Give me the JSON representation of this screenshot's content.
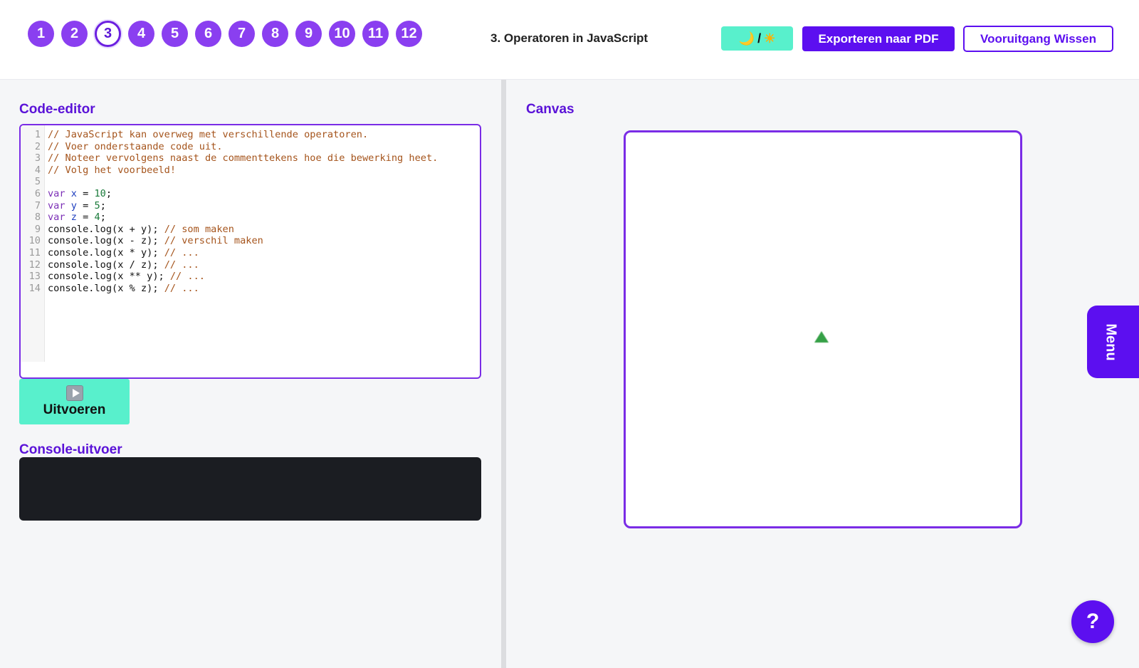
{
  "header": {
    "lessons": [
      "1",
      "2",
      "3",
      "4",
      "5",
      "6",
      "7",
      "8",
      "9",
      "10",
      "11",
      "12"
    ],
    "active_lesson": "3",
    "title": "3. Operatoren in JavaScript",
    "theme_toggle": {
      "moon_icon": "🌙",
      "separator": "/",
      "sun_icon": "☀"
    },
    "export_pdf_label": "Exporteren naar PDF",
    "reset_progress_label": "Vooruitgang Wissen"
  },
  "editor": {
    "title": "Code-editor",
    "lines": [
      {
        "n": "1",
        "segments": [
          {
            "t": "// JavaScript kan overweg met verschillende operatoren.",
            "c": "comment"
          }
        ]
      },
      {
        "n": "2",
        "segments": [
          {
            "t": "// Voer onderstaande code uit.",
            "c": "comment"
          }
        ]
      },
      {
        "n": "3",
        "segments": [
          {
            "t": "// Noteer vervolgens naast de commenttekens hoe die bewerking heet.",
            "c": "comment"
          }
        ]
      },
      {
        "n": "4",
        "segments": [
          {
            "t": "// Volg het voorbeeld!",
            "c": "comment"
          }
        ]
      },
      {
        "n": "5",
        "segments": []
      },
      {
        "n": "6",
        "segments": [
          {
            "t": "var",
            "c": "kw"
          },
          {
            "t": " "
          },
          {
            "t": "x",
            "c": "var"
          },
          {
            "t": " = "
          },
          {
            "t": "10",
            "c": "num"
          },
          {
            "t": ";"
          }
        ]
      },
      {
        "n": "7",
        "segments": [
          {
            "t": "var",
            "c": "kw"
          },
          {
            "t": " "
          },
          {
            "t": "y",
            "c": "var"
          },
          {
            "t": " = "
          },
          {
            "t": "5",
            "c": "num"
          },
          {
            "t": ";"
          }
        ]
      },
      {
        "n": "8",
        "segments": [
          {
            "t": "var",
            "c": "kw"
          },
          {
            "t": " "
          },
          {
            "t": "z",
            "c": "var"
          },
          {
            "t": " = "
          },
          {
            "t": "4",
            "c": "num"
          },
          {
            "t": ";"
          }
        ]
      },
      {
        "n": "9",
        "segments": [
          {
            "t": "console.log(x + y); "
          },
          {
            "t": "// som maken",
            "c": "comment"
          }
        ]
      },
      {
        "n": "10",
        "segments": [
          {
            "t": "console.log(x - z); "
          },
          {
            "t": "// verschil maken",
            "c": "comment"
          }
        ]
      },
      {
        "n": "11",
        "segments": [
          {
            "t": "console.log(x * y); "
          },
          {
            "t": "// ...",
            "c": "comment"
          }
        ]
      },
      {
        "n": "12",
        "segments": [
          {
            "t": "console.log(x / z); "
          },
          {
            "t": "// ...",
            "c": "comment"
          }
        ]
      },
      {
        "n": "13",
        "segments": [
          {
            "t": "console.log(x ** y); "
          },
          {
            "t": "// ...",
            "c": "comment"
          }
        ]
      },
      {
        "n": "14",
        "segments": [
          {
            "t": "console.log(x % z); "
          },
          {
            "t": "// ...",
            "c": "comment"
          }
        ]
      }
    ]
  },
  "run_button_label": "Uitvoeren",
  "console": {
    "title": "Console-uitvoer",
    "output": ""
  },
  "canvas": {
    "title": "Canvas"
  },
  "menu_label": "Menu",
  "help_label": "?",
  "colors": {
    "accent": "#5c0ff0",
    "lesson_bubble": "#8a3ff0",
    "teal": "#58f0cc",
    "console_bg": "#1b1d22",
    "turtle": "#35a046"
  }
}
